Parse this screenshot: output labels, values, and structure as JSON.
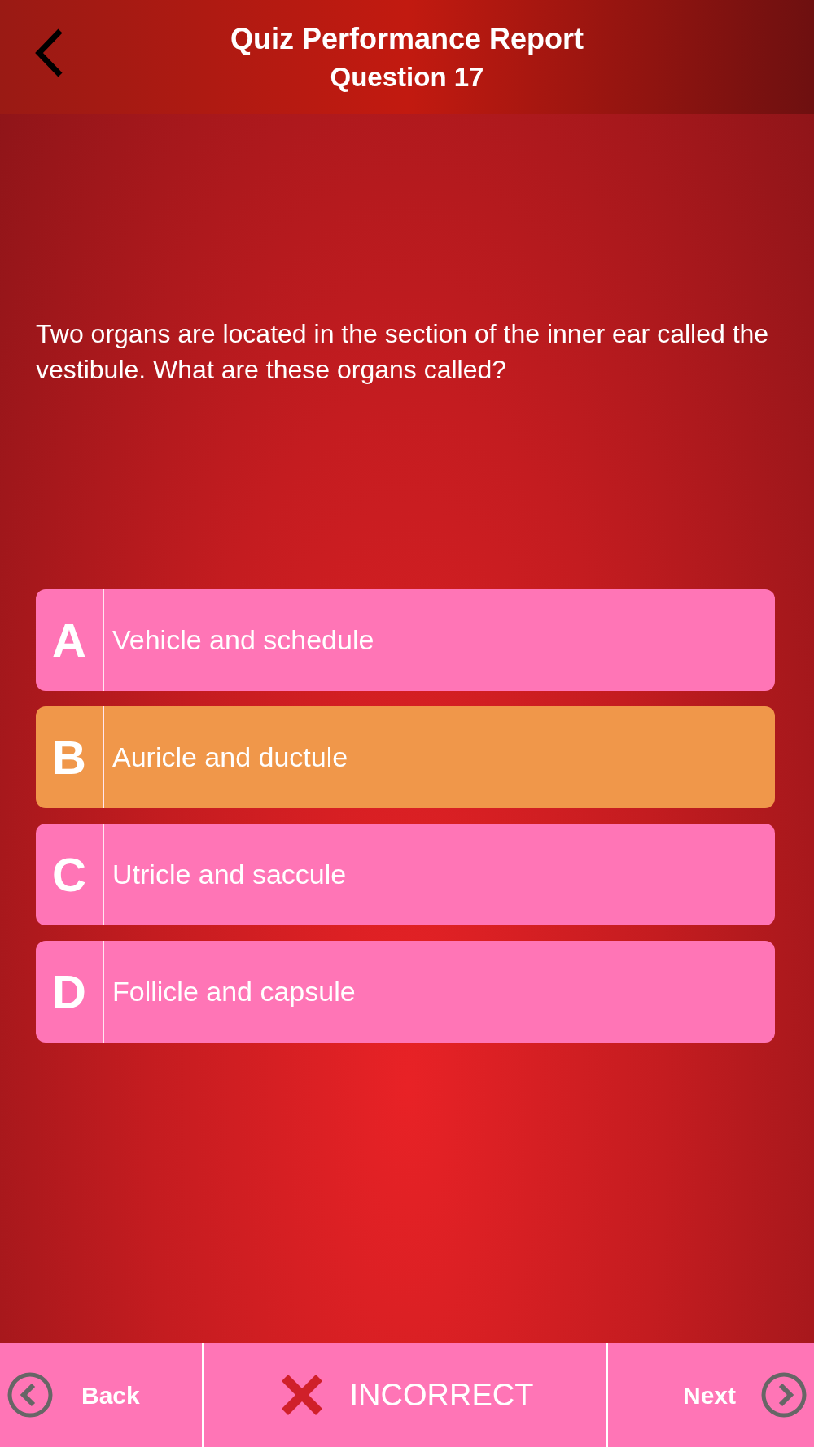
{
  "header": {
    "title": "Quiz Performance Report",
    "subtitle": "Question 17"
  },
  "question": "Two organs are located in the section of the inner ear called the vestibule. What are these organs called?",
  "options": [
    {
      "letter": "A",
      "text": "Vehicle and schedule",
      "selected": false
    },
    {
      "letter": "B",
      "text": "Auricle and ductule",
      "selected": true
    },
    {
      "letter": "C",
      "text": "Utricle and saccule",
      "selected": false
    },
    {
      "letter": "D",
      "text": "Follicle and capsule",
      "selected": false
    }
  ],
  "footer": {
    "back": "Back",
    "result": {
      "kind": "incorrect",
      "label": "INCORRECT"
    },
    "next": "Next"
  }
}
